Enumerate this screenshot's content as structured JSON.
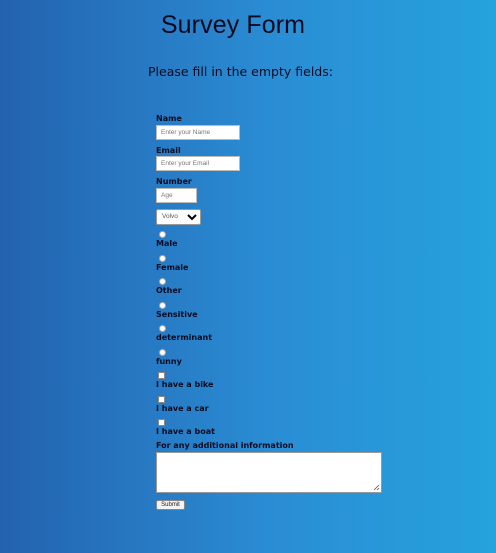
{
  "form": {
    "title": "Survey Form",
    "subtitle": "Please fill in the empty fields:",
    "name": {
      "label": "Name",
      "placeholder": "Enter your Name",
      "value": ""
    },
    "email": {
      "label": "Email",
      "placeholder": "Enter your Email",
      "value": ""
    },
    "number": {
      "label": "Number",
      "placeholder": "Age",
      "value": ""
    },
    "select": {
      "selected": "Volvo"
    },
    "radios": [
      {
        "label": "Male"
      },
      {
        "label": "Female"
      },
      {
        "label": "Other"
      },
      {
        "label": "Sensitive"
      },
      {
        "label": "determinant"
      },
      {
        "label": "funny"
      }
    ],
    "checkboxes": [
      {
        "label": "I have a bike"
      },
      {
        "label": "I have a car"
      },
      {
        "label": "I have a boat"
      }
    ],
    "additional": {
      "label": "For any additional information",
      "value": ""
    },
    "submit_label": "Submit"
  },
  "colors": {
    "gradient_left": "#2362ae",
    "gradient_right": "#26a2dd",
    "text": "#0a0a1e"
  }
}
